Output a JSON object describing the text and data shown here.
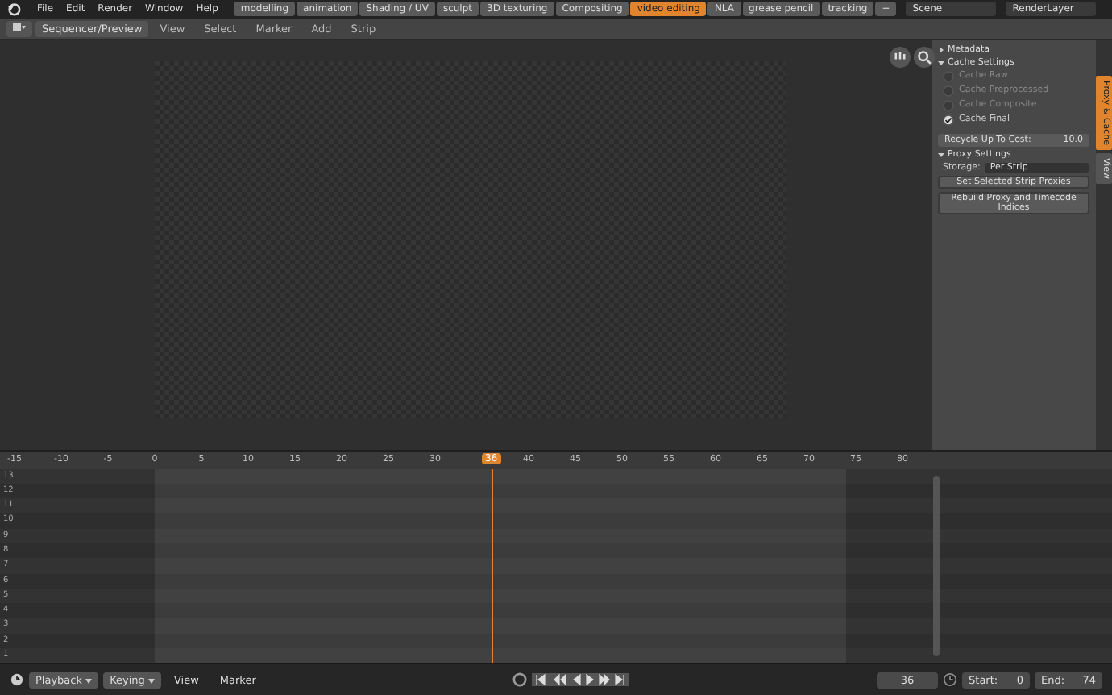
{
  "topbar": {
    "menu": [
      "File",
      "Edit",
      "Render",
      "Window",
      "Help"
    ],
    "workspaces": [
      {
        "label": "modelling",
        "selected": false
      },
      {
        "label": "animation",
        "selected": false
      },
      {
        "label": "Shading / UV",
        "selected": false
      },
      {
        "label": "sculpt",
        "selected": false
      },
      {
        "label": "3D texturing",
        "selected": false
      },
      {
        "label": "Compositing",
        "selected": false
      },
      {
        "label": "video editing",
        "selected": true
      },
      {
        "label": "NLA",
        "selected": false
      },
      {
        "label": "grease pencil",
        "selected": false
      },
      {
        "label": "tracking",
        "selected": false
      }
    ],
    "add_tab": "+",
    "scene": "Scene",
    "render_layer": "RenderLayer"
  },
  "header": {
    "editor": "Sequencer/Preview",
    "menu": [
      "View",
      "Select",
      "Marker",
      "Add",
      "Strip"
    ]
  },
  "panel": {
    "sections": [
      {
        "title": "Metadata",
        "expanded": false
      },
      {
        "kind": "cache",
        "title": "Cache Settings",
        "expanded": true,
        "options": [
          {
            "label": "Cache Raw",
            "checked": false
          },
          {
            "label": "Cache Preprocessed",
            "checked": false
          },
          {
            "label": "Cache Composite",
            "checked": false
          },
          {
            "label": "Cache Final",
            "checked": true
          }
        ],
        "recycle_label": "Recycle Up To Cost:",
        "recycle_value": "10.0"
      },
      {
        "kind": "proxy",
        "title": "Proxy Settings",
        "expanded": true,
        "storage_label": "Storage:",
        "storage_value": "Per Strip",
        "buttons": [
          "Set Selected Strip Proxies",
          "Rebuild Proxy and Timecode Indices"
        ]
      }
    ],
    "side_tabs": [
      {
        "label": "Proxy & Cache",
        "selected": true
      },
      {
        "label": "View",
        "selected": false
      }
    ]
  },
  "timeline": {
    "ticks": [
      "-15",
      "-10",
      "-5",
      "0",
      "5",
      "10",
      "15",
      "20",
      "25",
      "30",
      "40",
      "45",
      "50",
      "55",
      "60",
      "65",
      "70",
      "75",
      "80"
    ],
    "current_frame": "36",
    "channels": [
      "13",
      "12",
      "11",
      "10",
      "9",
      "8",
      "7",
      "6",
      "5",
      "4",
      "3",
      "2",
      "1"
    ]
  },
  "footer": {
    "dropdowns": [
      "Playback",
      "Keying"
    ],
    "menu": [
      "View",
      "Marker"
    ],
    "current_frame": "36",
    "start_label": "Start:",
    "start_value": "0",
    "end_label": "End:",
    "end_value": "74"
  }
}
